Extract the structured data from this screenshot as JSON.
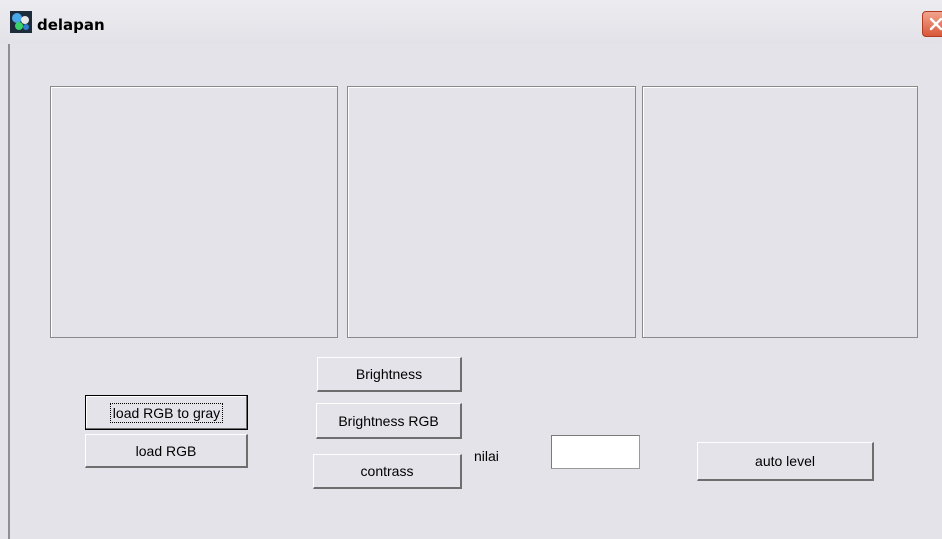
{
  "window": {
    "title": "delapan"
  },
  "buttons": {
    "brightness": "Brightness",
    "brightness_rgb": "Brightness RGB",
    "contrass": "contrass",
    "load_rgb_to_gray": "load RGB to gray",
    "load_rgb": "load RGB",
    "auto_level": "auto level"
  },
  "nilai": {
    "label": "nilai",
    "value": ""
  },
  "colors": {
    "form_background": "#e4e3ea",
    "close_button": "#d8583a"
  }
}
